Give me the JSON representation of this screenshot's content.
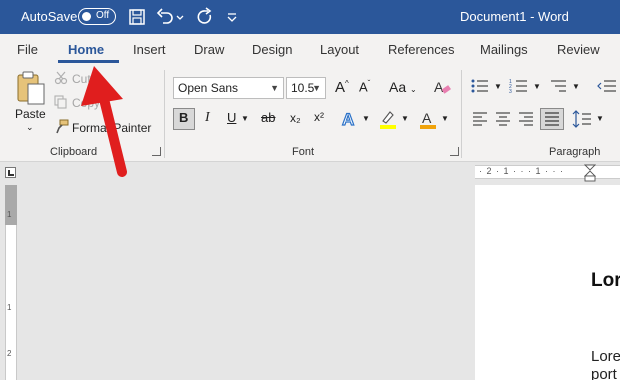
{
  "titlebar": {
    "autosave_label": "AutoSave",
    "toggle_state": "Off",
    "document_title": "Document1 - Word",
    "accent_color": "#2b579a"
  },
  "tabs": [
    {
      "label": "File"
    },
    {
      "label": "Home"
    },
    {
      "label": "Insert"
    },
    {
      "label": "Draw"
    },
    {
      "label": "Design"
    },
    {
      "label": "Layout"
    },
    {
      "label": "References"
    },
    {
      "label": "Mailings"
    },
    {
      "label": "Review"
    }
  ],
  "clipboard": {
    "paste_label": "Paste",
    "cut_label": "Cut",
    "copy_label": "Copy",
    "format_painter_label": "Format Painter",
    "group_label": "Clipboard"
  },
  "font": {
    "font_name": "Open Sans",
    "font_size": "10.5",
    "group_label": "Font",
    "bold": "B",
    "italic": "I",
    "underline": "U",
    "strike": "ab",
    "subscript": "x₂",
    "superscript": "x²",
    "grow": "A^",
    "shrink": "Aˇ",
    "change_case": "Aa"
  },
  "paragraph": {
    "group_label": "Paragraph"
  },
  "ruler": {
    "h_ticks": "· 2 · 1 · · · 1 · · ·",
    "v_numbers": [
      "1",
      "1",
      "2"
    ]
  },
  "document": {
    "heading": "Lor",
    "para_line1": "Lore",
    "para_line2": "port"
  },
  "annotation": {
    "arrow_color": "#e01e1e"
  }
}
